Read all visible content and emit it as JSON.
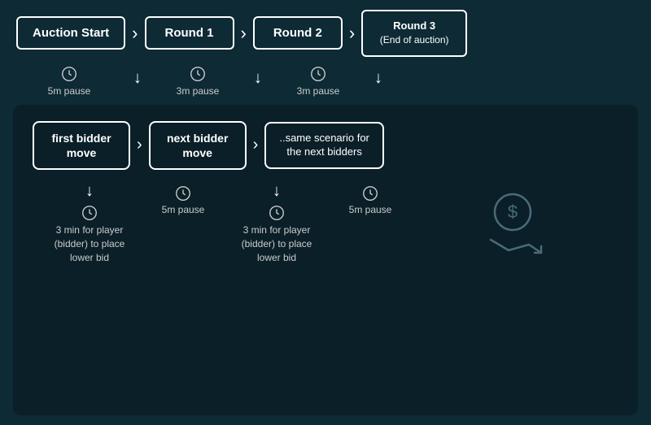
{
  "top": {
    "stages": [
      {
        "id": "auction-start",
        "label": "Auction Start"
      },
      {
        "id": "round1",
        "label": "Round 1"
      },
      {
        "id": "round2",
        "label": "Round 2"
      },
      {
        "id": "round3",
        "label": "Round 3\n(End of auction)"
      }
    ],
    "pauses": [
      {
        "id": "pause1",
        "duration": "5m pause"
      },
      {
        "id": "pause2",
        "duration": "3m pause"
      },
      {
        "id": "pause3",
        "duration": "3m pause"
      }
    ]
  },
  "bottom": {
    "bidders": [
      {
        "id": "first-bidder",
        "label": "first bidder\nmove"
      },
      {
        "id": "next-bidder",
        "label": "next bidder\nmove"
      },
      {
        "id": "scenario",
        "label": "..same scenario for\nthe next bidders"
      }
    ],
    "details": [
      {
        "id": "detail1",
        "pause_label": "5m pause",
        "timer_label": "3 min for player\n(bidder) to place\nlower bid"
      },
      {
        "id": "detail2",
        "pause_label": "5m pause",
        "timer_label": "3 min for player\n(bidder) to place\nlower bid"
      }
    ],
    "money_icon": "dollar-trend-icon"
  }
}
